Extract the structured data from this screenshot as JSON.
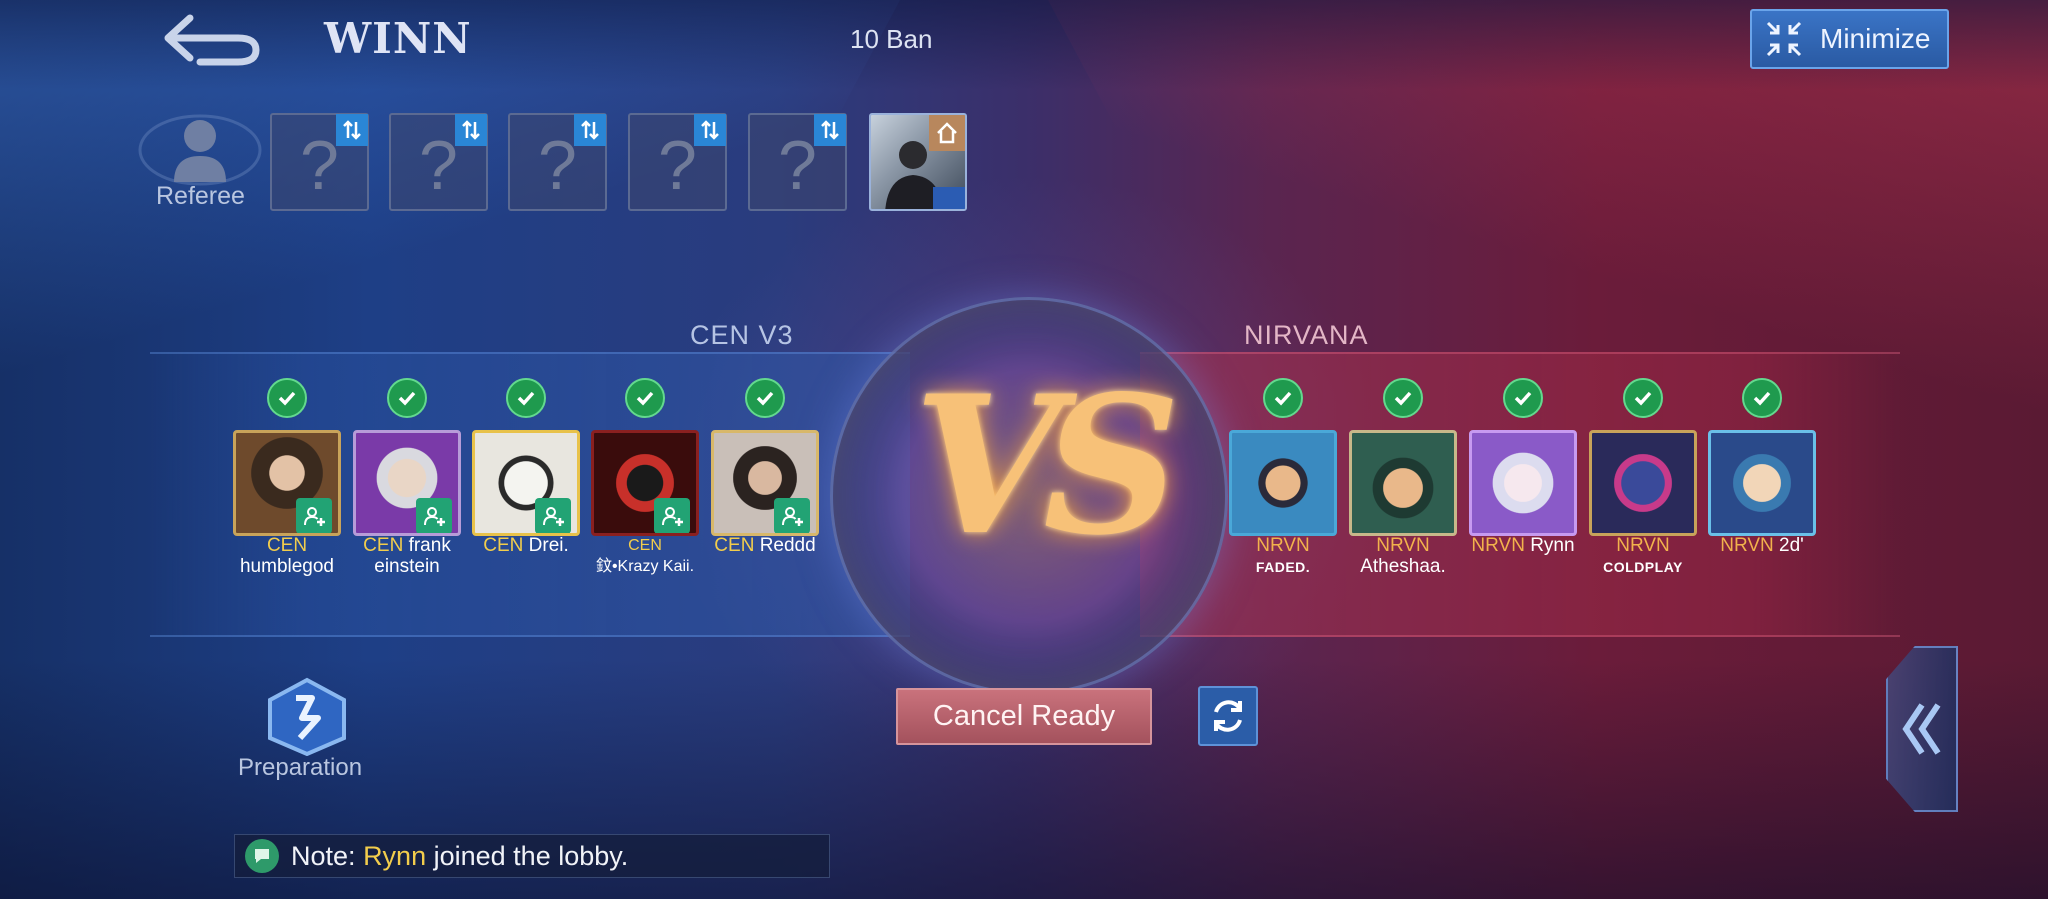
{
  "header": {
    "title": "WINN",
    "ban_mode": "10 Ban",
    "minimize_label": "Minimize"
  },
  "referee": {
    "label": "Referee"
  },
  "ban_slots": [
    "?",
    "?",
    "?",
    "?",
    "?"
  ],
  "teams": {
    "left": {
      "name": "CEN V3",
      "players": [
        {
          "tag": "CEN",
          "name": "humblegod"
        },
        {
          "tag": "CEN",
          "name": "frank einstein"
        },
        {
          "tag": "CEN",
          "name": "Drei."
        },
        {
          "tag": "CEN",
          "name": "鈫•Krazy Kaii."
        },
        {
          "tag": "CEN",
          "name": "Reddd"
        }
      ]
    },
    "right": {
      "name": "NIRVANA",
      "players": [
        {
          "tag": "NRVN",
          "name": "FADED."
        },
        {
          "tag": "NRVN",
          "name": "Atheshaa."
        },
        {
          "tag": "NRVN",
          "name": "Rynn"
        },
        {
          "tag": "NRVN",
          "name": "COLDPLAY"
        },
        {
          "tag": "NRVN",
          "name": "2d'"
        }
      ]
    }
  },
  "vs_label": "VS",
  "actions": {
    "preparation_label": "Preparation",
    "cancel_ready_label": "Cancel Ready"
  },
  "note": {
    "prefix": "Note:",
    "player": "Rynn",
    "message": "joined the lobby."
  },
  "colors": {
    "accent_blue": "#2a5aa3",
    "accent_red": "#a4525d",
    "ready_green": "#1f9a4e",
    "team_tag": "#f2cd4c"
  }
}
